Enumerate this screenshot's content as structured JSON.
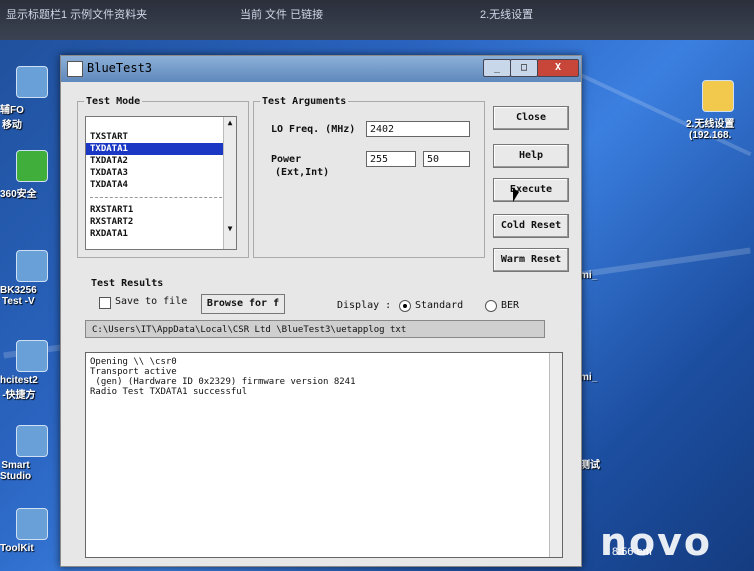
{
  "desktop": {
    "top_strip": [
      "显示标题栏1   示例文件资料夹",
      "当前  文件   已链接",
      "2.无线设置"
    ],
    "left_icons": [
      {
        "label": "辅FO\n移动",
        "icon": "folder-icon"
      },
      {
        "label": "360安全",
        "icon": "shield-icon"
      },
      {
        "label": "BK3256\nTest -V",
        "icon": "app-icon"
      },
      {
        "label": "hcitest2\n-快捷方",
        "icon": "app-icon"
      },
      {
        "label": "Smart\nStudio",
        "icon": "app-icon"
      },
      {
        "label": "ToolKit",
        "icon": "app-icon"
      }
    ],
    "right_icons": [
      {
        "label": "2.无线设置\n(192.168.",
        "icon": "folder-icon"
      },
      {
        "label": "mi_",
        "icon": "app-icon"
      },
      {
        "label": "mi_",
        "icon": "app-icon"
      },
      {
        "label": "测试",
        "icon": "app-icon"
      }
    ],
    "brand": "novo",
    "clock": "8:56 em"
  },
  "window": {
    "title": "BlueTest3",
    "minimize": "_",
    "maximize": "□",
    "close": "X",
    "test_mode": {
      "legend": "Test Mode",
      "items": [
        "TXSTART",
        "TXDATA1",
        "TXDATA2",
        "TXDATA3",
        "TXDATA4",
        "RXSTART1",
        "RXSTART2",
        "RXDATA1"
      ],
      "selected_index": 1
    },
    "test_arguments": {
      "legend": "Test Arguments",
      "lo_freq_label": "LO Freq. (MHz)",
      "lo_freq_value": "2402",
      "power_label": "Power",
      "power_sublabel": "(Ext,Int)",
      "power_ext": "255",
      "power_int": "50"
    },
    "buttons": {
      "close": "Close",
      "help": "Help",
      "execute": "Execute",
      "cold_reset": "Cold Reset",
      "warm_reset": "Warm Reset"
    },
    "test_results": {
      "legend": "Test Results",
      "save_to_file": "Save to file",
      "browse": "Browse for f",
      "display_label": "Display :",
      "standard": "Standard",
      "ber": "BER",
      "path": "C:\\Users\\IT\\AppData\\Local\\CSR Ltd \\BlueTest3\\uetapplog txt"
    },
    "log_lines": [
      "Opening \\\\ \\csr0",
      "Transport active",
      " (gen) (Hardware ID 0x2329) firmware version 8241",
      "Radio Test TXDATA1 successful"
    ]
  }
}
